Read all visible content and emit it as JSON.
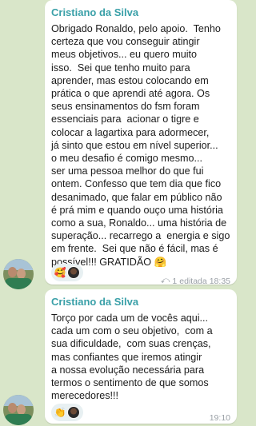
{
  "messages": [
    {
      "sender": "Cristiano da Silva",
      "text": "Obrigado Ronaldo, pelo apoio.  Tenho\ncerteza que vou conseguir atingir\nmeus objetivos... eu quero muito\nisso.  Sei que tenho muito para\naprender, mas estou colocando em\nprática o que aprendi até agora. Os\nseus ensinamentos do fsm foram\nessenciais para  acionar o tigre e\ncolocar a lagartixa para adormecer,\njá sinto que estou em nível superior...\no meu desafio é comigo mesmo...\nser uma pessoa melhor do que fui\nontem. Confesso que tem dia que fico\ndesanimado, que falar em público não\né prá mim e quando ouço uma história\ncomo a sua, Ronaldo... uma história de\nsuperação... recarrego a  energia e sigo\nem frente.  Sei que não é fácil, mas é\npossível!!! GRATIDÃO 🤗",
      "reaction_emoji": "🥰",
      "reply_count": "1",
      "edited_label": "editada",
      "time": "18:35",
      "reply_icon": "reply-arrow-icon"
    },
    {
      "sender": "Cristiano da Silva",
      "text": "Torço por cada um de vocês aqui...\ncada um com o seu objetivo,  com a\nsua dificuldade,  com suas crenças,\nmas confiantes que iremos atingir\na nossa evolução necessária para\ntermos o sentimento de que somos\nmerecedores!!!",
      "reaction_emoji": "👏",
      "time": "19:10"
    }
  ]
}
